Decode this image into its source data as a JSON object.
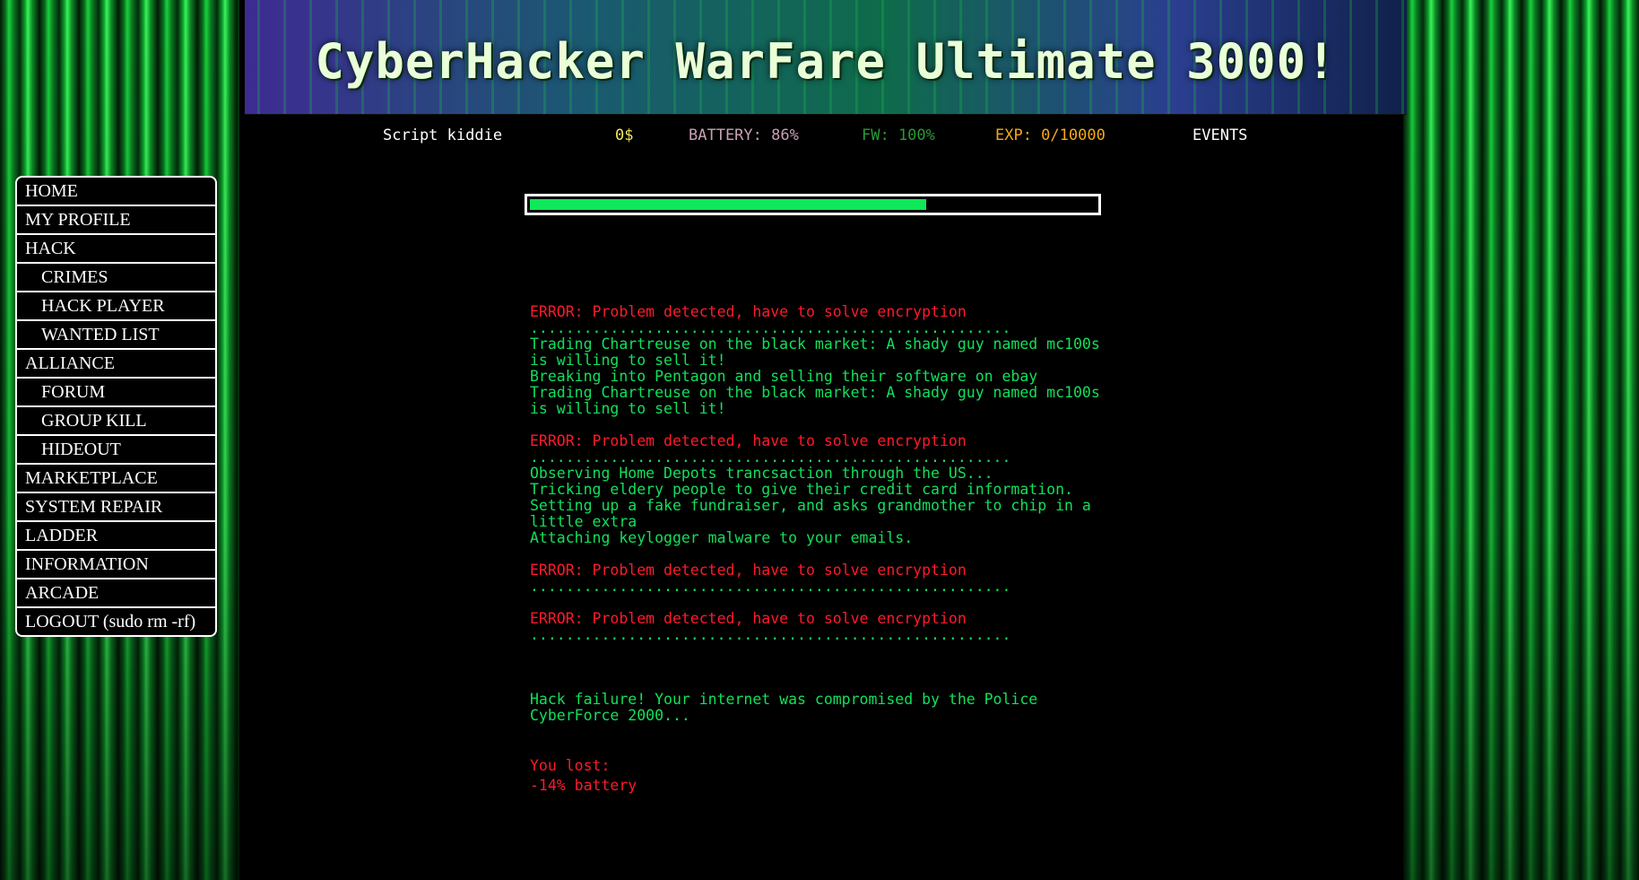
{
  "app": {
    "title": "CyberHacker WarFare Ultimate 3000!"
  },
  "status": {
    "rank": "Script kiddie",
    "money": "0$",
    "battery": "BATTERY: 86%",
    "firewall": "FW: 100%",
    "experience": "EXP: 0/10000",
    "events": "EVENTS"
  },
  "progress": {
    "value": 0.7,
    "fill_color": "#0ee85a"
  },
  "nav": {
    "items": [
      {
        "label": "HOME",
        "sub": false
      },
      {
        "label": "MY PROFILE",
        "sub": false
      },
      {
        "label": "HACK",
        "sub": false
      },
      {
        "label": "CRIMES",
        "sub": true
      },
      {
        "label": "HACK PLAYER",
        "sub": true
      },
      {
        "label": "WANTED LIST",
        "sub": true
      },
      {
        "label": "ALLIANCE",
        "sub": false
      },
      {
        "label": "FORUM",
        "sub": true
      },
      {
        "label": "GROUP KILL",
        "sub": true
      },
      {
        "label": "HIDEOUT",
        "sub": true
      },
      {
        "label": "MARKETPLACE",
        "sub": false
      },
      {
        "label": "SYSTEM REPAIR",
        "sub": false
      },
      {
        "label": "LADDER",
        "sub": false
      },
      {
        "label": "INFORMATION",
        "sub": false
      },
      {
        "label": "ARCADE",
        "sub": false
      },
      {
        "label": "LOGOUT (sudo rm -rf)",
        "sub": false
      }
    ]
  },
  "log": {
    "error": "ERROR: Problem detected, have to solve encryption",
    "dots": "......................................................",
    "lines": [
      "Trading Chartreuse on the black market: A shady guy named mc100s is willing to sell it!",
      "Breaking into Pentagon and selling their software on ebay",
      "Trading Chartreuse on the black market: A shady guy named mc100s is willing to sell it!",
      "Observing Home Depots trancsaction through the US...",
      "Tricking eldery people to give their credit card information.",
      "Setting up a fake fundraiser, and asks grandmother to chip in a little extra",
      "Attaching keylogger malware to your emails."
    ],
    "result": "Hack failure! Your internet was compromised by the Police CyberForce 2000..."
  },
  "loss": {
    "title": "You lost:",
    "value": "-14% battery"
  },
  "colors": {
    "error": "#ff1a2a",
    "success": "#12e05a",
    "money": "#f2e85a",
    "experience": "#f4a818"
  }
}
